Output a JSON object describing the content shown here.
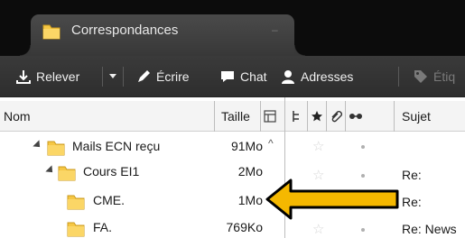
{
  "window": {
    "tab_title": "Correspondances"
  },
  "toolbar": {
    "get_mail_label": "Relever",
    "write_label": "Écrire",
    "chat_label": "Chat",
    "address_book_label": "Adresses",
    "tag_label": "Étiq"
  },
  "folder_columns": {
    "name_header": "Nom",
    "size_header": "Taille"
  },
  "message_columns": {
    "subject_header": "Sujet"
  },
  "folders": [
    {
      "name": "Mails ECN reçu",
      "size": "91Mo"
    },
    {
      "name": "Cours EI1",
      "size": "2Mo"
    },
    {
      "name": "CME.",
      "size": "1Mo"
    },
    {
      "name": "FA.",
      "size": "769Ko"
    }
  ],
  "messages": [
    {
      "subject": ""
    },
    {
      "subject": "Re:"
    },
    {
      "subject": "Re:"
    },
    {
      "subject": "Re: News"
    }
  ],
  "colors": {
    "titlebar_bg": "#0c0c0c",
    "toolbar_bg": "#333333",
    "folder_yellow": "#f6c744",
    "arrow_fill": "#f5b800"
  }
}
